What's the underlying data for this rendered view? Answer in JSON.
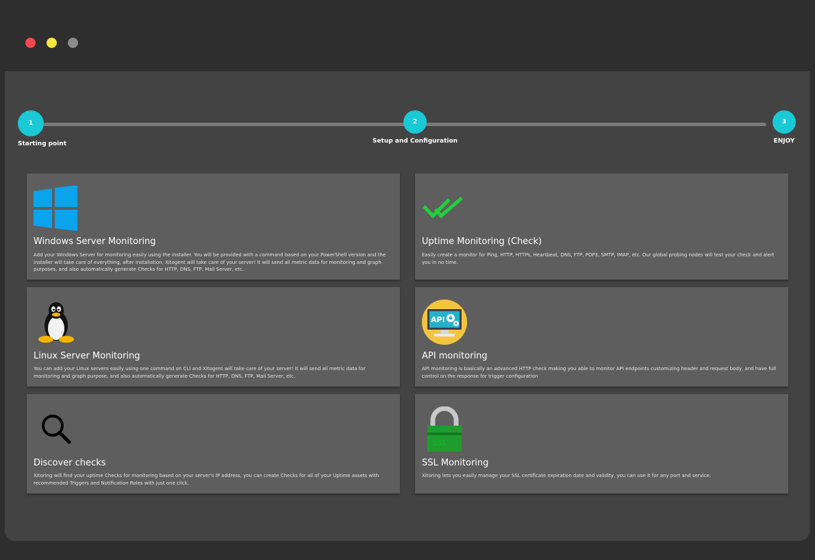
{
  "window_controls": {
    "close": "close-dot",
    "minimize": "minimize-dot",
    "zoom": "zoom-dot"
  },
  "stepper": {
    "steps": [
      {
        "number": "1",
        "label": "Starting point"
      },
      {
        "number": "2",
        "label": "Setup and Configuration"
      },
      {
        "number": "3",
        "label": "ENJOY"
      }
    ],
    "accent": "#19c9d6"
  },
  "cards": [
    {
      "icon": "windows-logo-icon",
      "title": "Windows Server Monitoring",
      "description": "Add your Windows Server for monitoring easily using the installer. You will be provided with a command based on your PowerShell version and the installer will take care of everything, after installation, Xitogent will take care of your server! It will send all metric data for monitoring and graph purposes, and also automatically generate Checks for HTTP, DNS, FTP, Mail Server, etc."
    },
    {
      "icon": "double-check-icon",
      "title": "Uptime Monitoring (Check)",
      "description": "Easily create a monitor for Ping, HTTP, HTTPs, Heartbeat, DNS, FTP, POP3, SMTP, IMAP, etc. Our global probing nodes will test your check and alert you in no time."
    },
    {
      "icon": "linux-penguin-icon",
      "title": "Linux Server Monitoring",
      "description": "You can add your Linux servers easily using one command on CLI and Xitogent will take care of your server! It will send all metric data for monitoring and graph purpose, and also automatically generate Checks for HTTP, DNS, FTP, Mail Server, etc."
    },
    {
      "icon": "api-monitor-icon",
      "icon_text": "API",
      "title": "API monitoring",
      "description": "API monitoring is basically an advanced HTTP check making you able to monitor API endpoints customizing header and request body, and have full control on the response for trigger configuration"
    },
    {
      "icon": "search-icon",
      "title": "Discover checks",
      "description": "Xitoring will find your uptime Checks for monitoring based on your server's IP address, you can create Checks for all of your Uptime assets with recommended Triggers and Notification Roles with just one click."
    },
    {
      "icon": "ssl-lock-icon",
      "icon_text": "SSL",
      "title": "SSL Monitoring",
      "description": "Xitoring lets you easily manage your SSL certificate expiration date and validity, you can use it for any port and service."
    }
  ]
}
